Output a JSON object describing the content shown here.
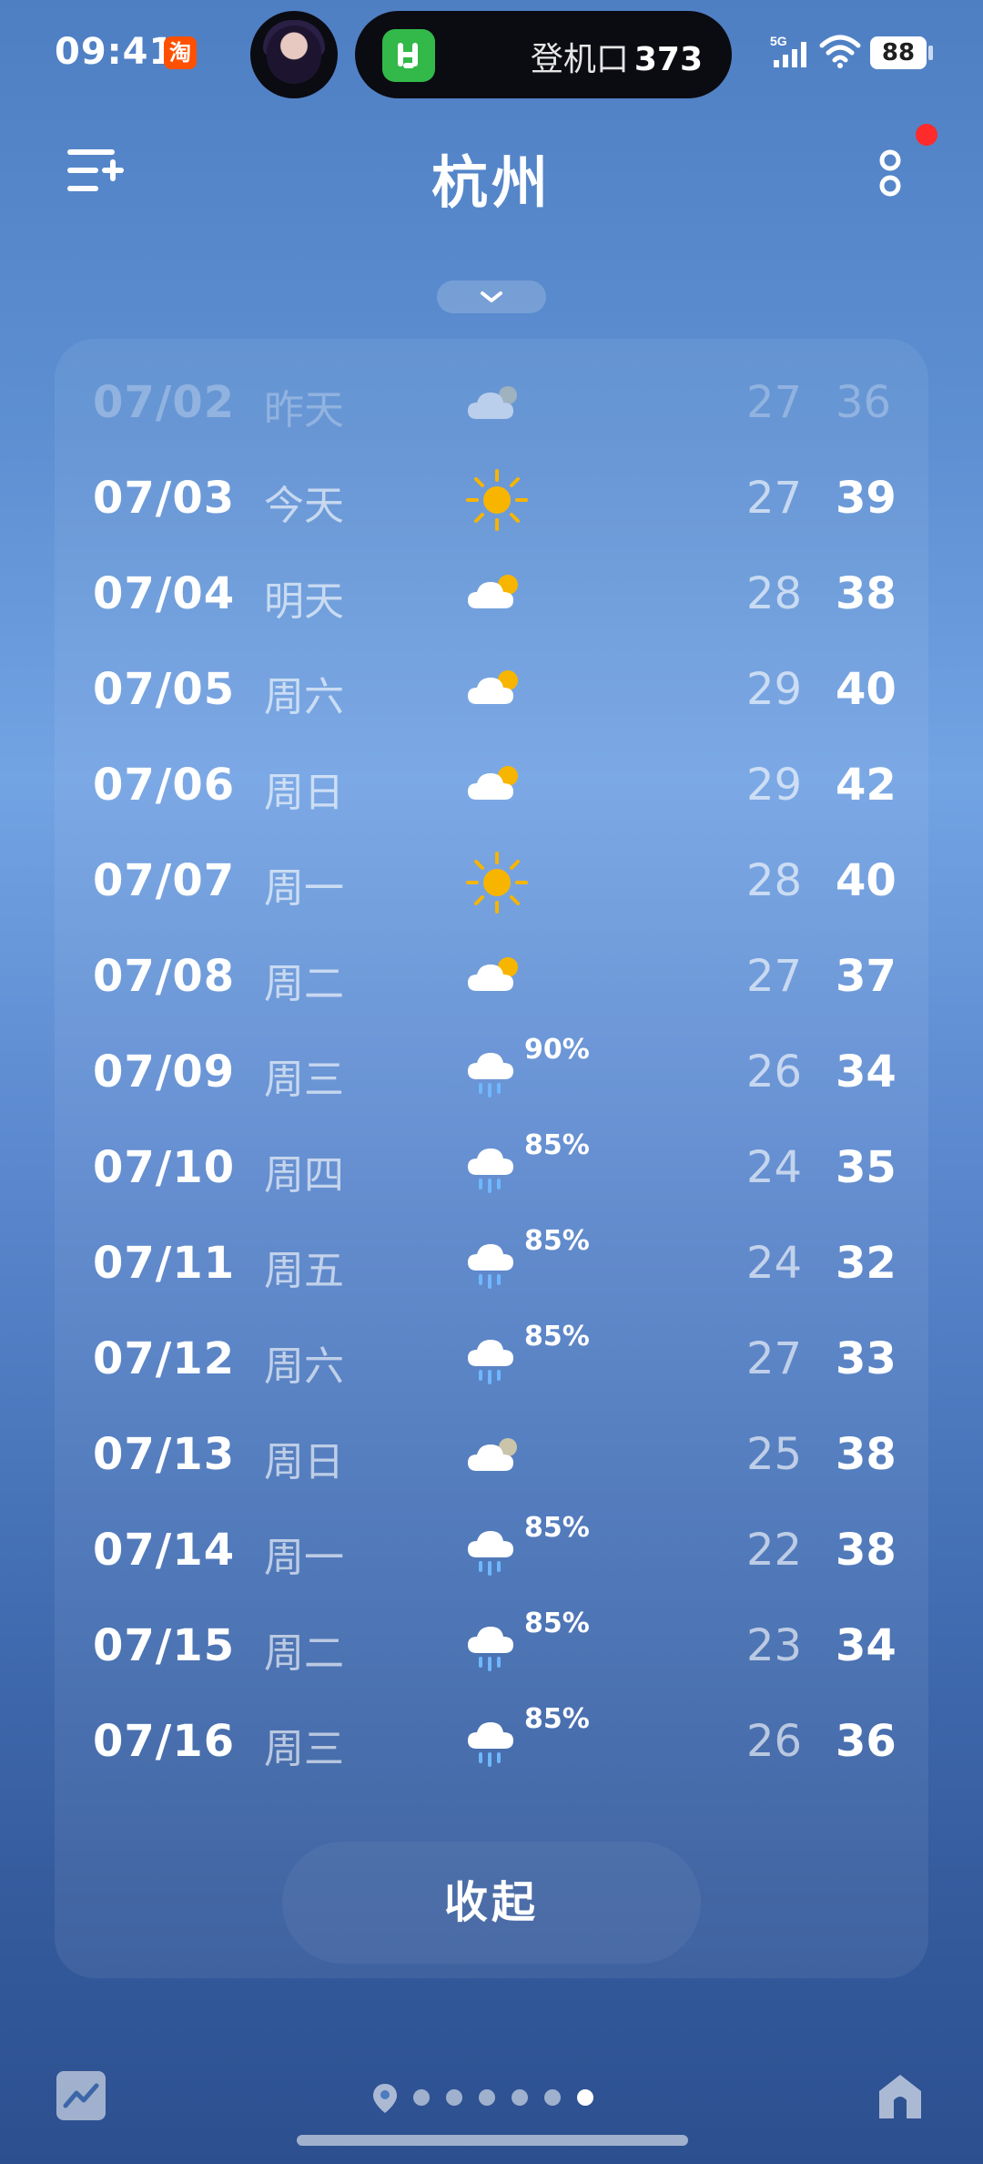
{
  "status_bar": {
    "time": "09:41",
    "taobao_glyph": "淘",
    "island_text": "登机口",
    "island_number": "373",
    "network": "5G",
    "battery": "88"
  },
  "header": {
    "city": "杭州",
    "menu_icon": "add-city-list-icon",
    "more_icon": "more-vertical-icon",
    "notification_color": "#ff2a2a"
  },
  "forecast": [
    {
      "date": "07/02",
      "day": "昨天",
      "icon": "cloudy",
      "precip": "",
      "low": "27",
      "high": "36",
      "past": true
    },
    {
      "date": "07/03",
      "day": "今天",
      "icon": "sunny",
      "precip": "",
      "low": "27",
      "high": "39"
    },
    {
      "date": "07/04",
      "day": "明天",
      "icon": "partly-cloudy",
      "precip": "",
      "low": "28",
      "high": "38"
    },
    {
      "date": "07/05",
      "day": "周六",
      "icon": "partly-cloudy",
      "precip": "",
      "low": "29",
      "high": "40"
    },
    {
      "date": "07/06",
      "day": "周日",
      "icon": "partly-cloudy",
      "precip": "",
      "low": "29",
      "high": "42"
    },
    {
      "date": "07/07",
      "day": "周一",
      "icon": "sunny",
      "precip": "",
      "low": "28",
      "high": "40"
    },
    {
      "date": "07/08",
      "day": "周二",
      "icon": "partly-cloudy",
      "precip": "",
      "low": "27",
      "high": "37"
    },
    {
      "date": "07/09",
      "day": "周三",
      "icon": "rain",
      "precip": "90%",
      "low": "26",
      "high": "34"
    },
    {
      "date": "07/10",
      "day": "周四",
      "icon": "rain",
      "precip": "85%",
      "low": "24",
      "high": "35"
    },
    {
      "date": "07/11",
      "day": "周五",
      "icon": "rain",
      "precip": "85%",
      "low": "24",
      "high": "32"
    },
    {
      "date": "07/12",
      "day": "周六",
      "icon": "rain",
      "precip": "85%",
      "low": "27",
      "high": "33"
    },
    {
      "date": "07/13",
      "day": "周日",
      "icon": "cloudy",
      "precip": "",
      "low": "25",
      "high": "38"
    },
    {
      "date": "07/14",
      "day": "周一",
      "icon": "rain",
      "precip": "85%",
      "low": "22",
      "high": "38"
    },
    {
      "date": "07/15",
      "day": "周二",
      "icon": "rain",
      "precip": "85%",
      "low": "23",
      "high": "34"
    },
    {
      "date": "07/16",
      "day": "周三",
      "icon": "rain",
      "precip": "85%",
      "low": "26",
      "high": "36"
    }
  ],
  "collapse_label": "收起",
  "bottom_bar": {
    "trend_icon": "trend-chart-icon",
    "location_icon": "location-pin-icon",
    "page_count": 6,
    "active_page": 6,
    "home_icon": "home-icon"
  },
  "colors": {
    "sun": "#f7b500",
    "background_top": "#4f7fc3",
    "background_bottom": "#2c4f8f"
  }
}
